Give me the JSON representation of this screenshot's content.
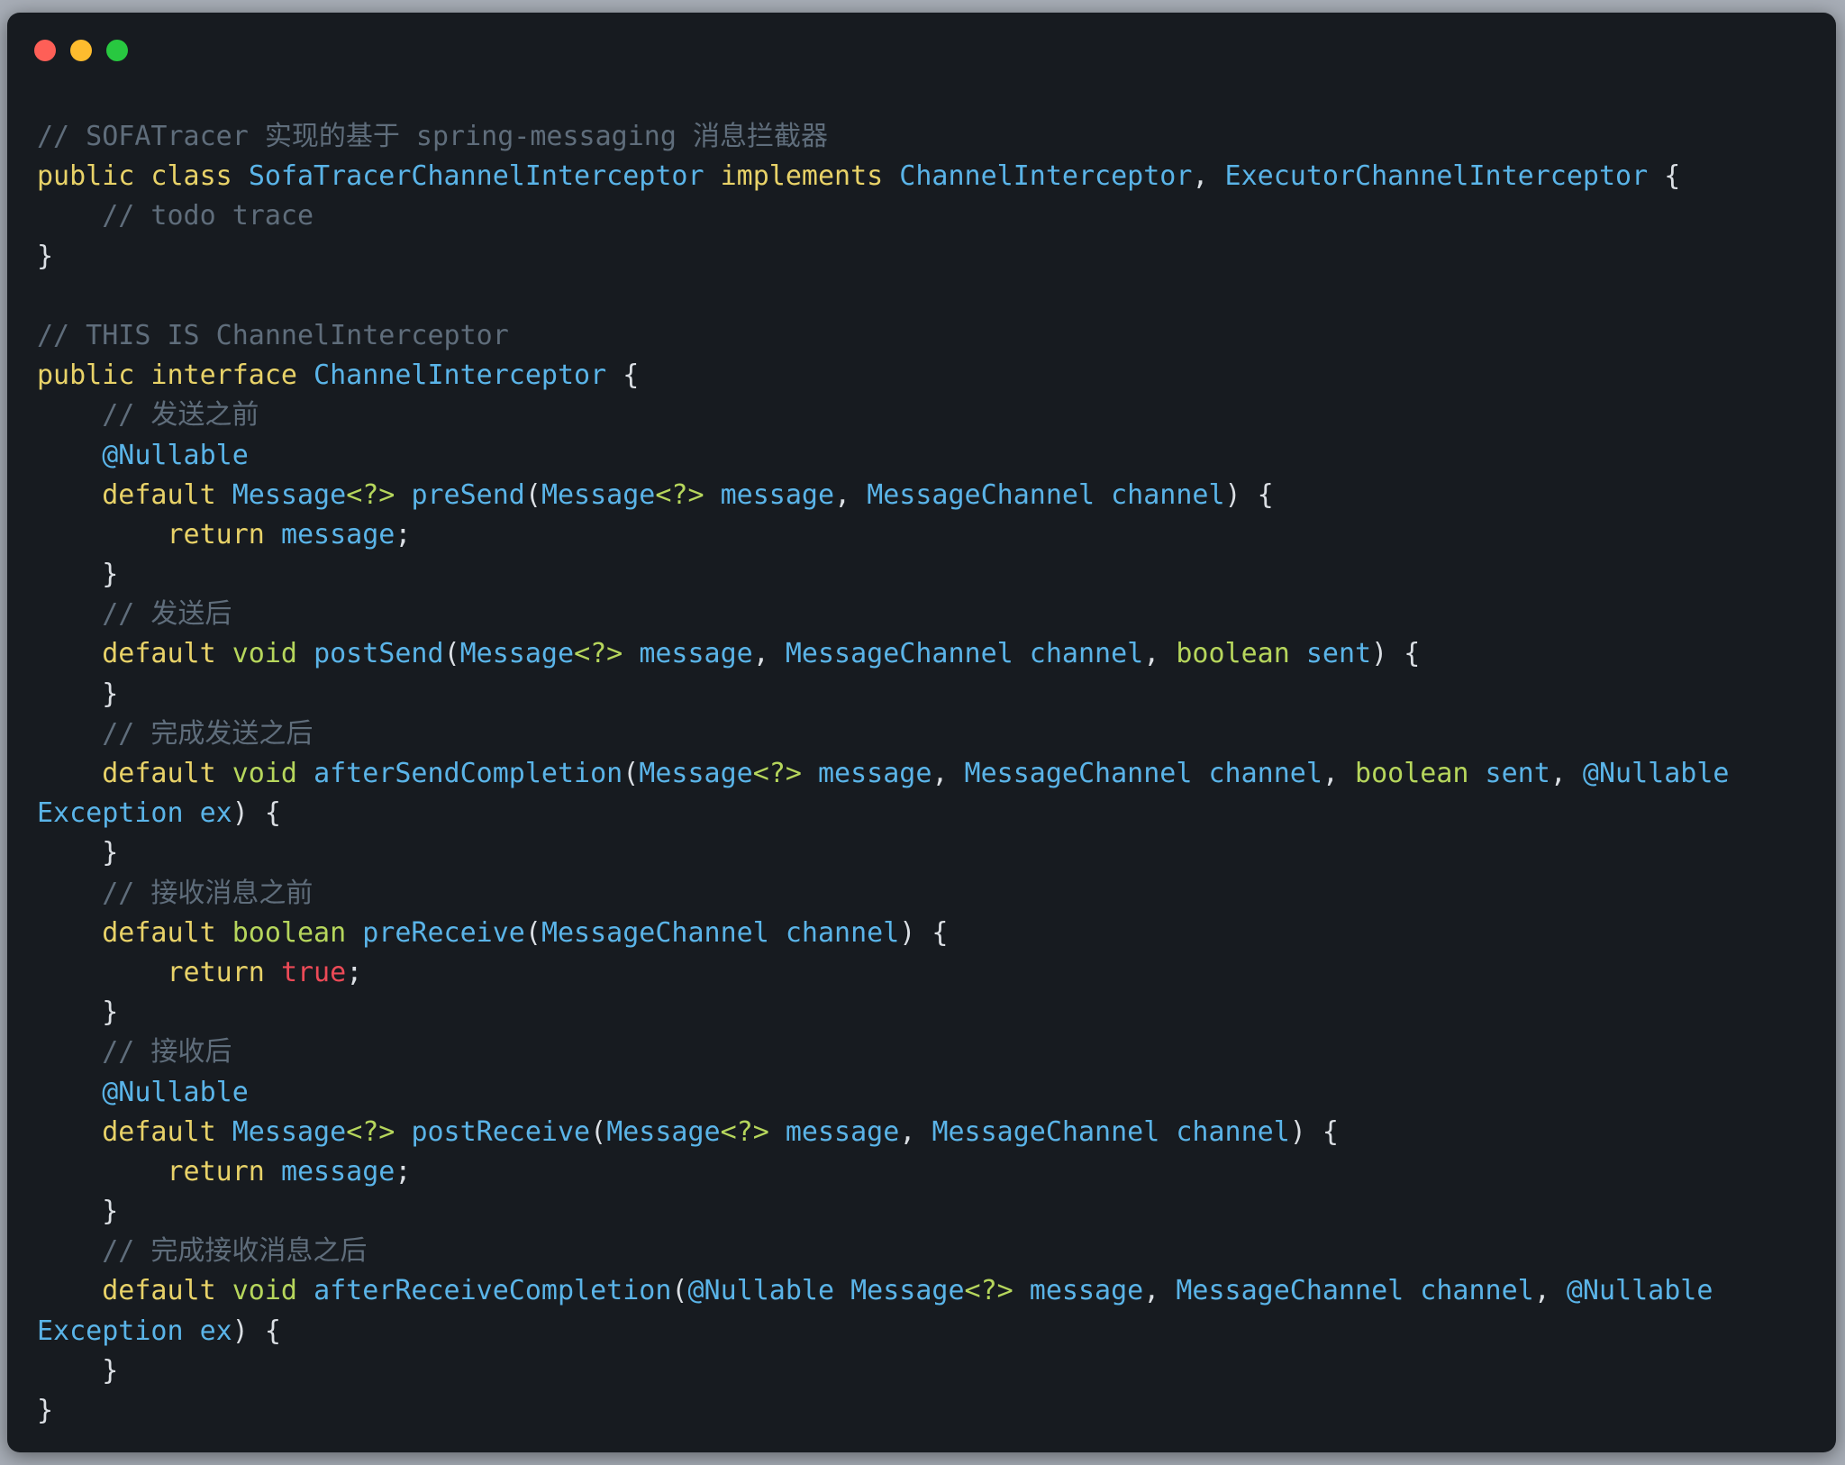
{
  "window": {
    "controls": [
      "close",
      "minimize",
      "maximize"
    ],
    "colors": {
      "close": "#fe5f57",
      "minimize": "#febc2e",
      "maximize": "#28c840",
      "background": "#171b20"
    }
  },
  "code": {
    "language": "java",
    "lines": [
      [
        [
          "cm",
          "// SOFATracer 实现的基于 spring-messaging 消息拦截器"
        ]
      ],
      [
        [
          "kw",
          "public class "
        ],
        [
          "ty",
          "SofaTracerChannelInterceptor "
        ],
        [
          "kw",
          "implements "
        ],
        [
          "ty",
          "ChannelInterceptor"
        ],
        [
          "pl",
          ", "
        ],
        [
          "ty",
          "ExecutorChannelInterceptor "
        ],
        [
          "pl",
          "{"
        ]
      ],
      [
        [
          "pl",
          "    "
        ],
        [
          "cm",
          "// todo trace"
        ]
      ],
      [
        [
          "pl",
          "}"
        ]
      ],
      [],
      [
        [
          "cm",
          "// THIS IS ChannelInterceptor"
        ]
      ],
      [
        [
          "kw",
          "public interface "
        ],
        [
          "ty",
          "ChannelInterceptor "
        ],
        [
          "pl",
          "{"
        ]
      ],
      [
        [
          "pl",
          "    "
        ],
        [
          "cm",
          "// 发送之前"
        ]
      ],
      [
        [
          "pl",
          "    "
        ],
        [
          "ty",
          "@Nullable"
        ]
      ],
      [
        [
          "pl",
          "    "
        ],
        [
          "kw",
          "default "
        ],
        [
          "ty",
          "Message"
        ],
        [
          "gen",
          "<?>"
        ],
        [
          "pl",
          " "
        ],
        [
          "ty",
          "preSend"
        ],
        [
          "pl",
          "("
        ],
        [
          "ty",
          "Message"
        ],
        [
          "gen",
          "<?>"
        ],
        [
          "pl",
          " "
        ],
        [
          "ty",
          "message"
        ],
        [
          "pl",
          ", "
        ],
        [
          "ty",
          "MessageChannel channel"
        ],
        [
          "pl",
          ") {"
        ]
      ],
      [
        [
          "pl",
          "        "
        ],
        [
          "kw",
          "return "
        ],
        [
          "ty",
          "message"
        ],
        [
          "pl",
          ";"
        ]
      ],
      [
        [
          "pl",
          "    }"
        ]
      ],
      [
        [
          "pl",
          "    "
        ],
        [
          "cm",
          "// 发送后"
        ]
      ],
      [
        [
          "pl",
          "    "
        ],
        [
          "kw",
          "default "
        ],
        [
          "prim",
          "void "
        ],
        [
          "ty",
          "postSend"
        ],
        [
          "pl",
          "("
        ],
        [
          "ty",
          "Message"
        ],
        [
          "gen",
          "<?>"
        ],
        [
          "pl",
          " "
        ],
        [
          "ty",
          "message"
        ],
        [
          "pl",
          ", "
        ],
        [
          "ty",
          "MessageChannel channel"
        ],
        [
          "pl",
          ", "
        ],
        [
          "prim",
          "boolean "
        ],
        [
          "ty",
          "sent"
        ],
        [
          "pl",
          ") {"
        ]
      ],
      [
        [
          "pl",
          "    }"
        ]
      ],
      [
        [
          "pl",
          "    "
        ],
        [
          "cm",
          "// 完成发送之后"
        ]
      ],
      [
        [
          "pl",
          "    "
        ],
        [
          "kw",
          "default "
        ],
        [
          "prim",
          "void "
        ],
        [
          "ty",
          "afterSendCompletion"
        ],
        [
          "pl",
          "("
        ],
        [
          "ty",
          "Message"
        ],
        [
          "gen",
          "<?>"
        ],
        [
          "pl",
          " "
        ],
        [
          "ty",
          "message"
        ],
        [
          "pl",
          ", "
        ],
        [
          "ty",
          "MessageChannel channel"
        ],
        [
          "pl",
          ", "
        ],
        [
          "prim",
          "boolean "
        ],
        [
          "ty",
          "sent"
        ],
        [
          "pl",
          ", "
        ],
        [
          "ty",
          "@Nullable"
        ]
      ],
      [
        [
          "ty",
          "Exception ex"
        ],
        [
          "pl",
          ") {"
        ]
      ],
      [
        [
          "pl",
          "    }"
        ]
      ],
      [
        [
          "pl",
          "    "
        ],
        [
          "cm",
          "// 接收消息之前"
        ]
      ],
      [
        [
          "pl",
          "    "
        ],
        [
          "kw",
          "default "
        ],
        [
          "prim",
          "boolean "
        ],
        [
          "ty",
          "preReceive"
        ],
        [
          "pl",
          "("
        ],
        [
          "ty",
          "MessageChannel channel"
        ],
        [
          "pl",
          ") {"
        ]
      ],
      [
        [
          "pl",
          "        "
        ],
        [
          "kw",
          "return "
        ],
        [
          "lit",
          "true"
        ],
        [
          "pl",
          ";"
        ]
      ],
      [
        [
          "pl",
          "    }"
        ]
      ],
      [
        [
          "pl",
          "    "
        ],
        [
          "cm",
          "// 接收后"
        ]
      ],
      [
        [
          "pl",
          "    "
        ],
        [
          "ty",
          "@Nullable"
        ]
      ],
      [
        [
          "pl",
          "    "
        ],
        [
          "kw",
          "default "
        ],
        [
          "ty",
          "Message"
        ],
        [
          "gen",
          "<?>"
        ],
        [
          "pl",
          " "
        ],
        [
          "ty",
          "postReceive"
        ],
        [
          "pl",
          "("
        ],
        [
          "ty",
          "Message"
        ],
        [
          "gen",
          "<?>"
        ],
        [
          "pl",
          " "
        ],
        [
          "ty",
          "message"
        ],
        [
          "pl",
          ", "
        ],
        [
          "ty",
          "MessageChannel channel"
        ],
        [
          "pl",
          ") {"
        ]
      ],
      [
        [
          "pl",
          "        "
        ],
        [
          "kw",
          "return "
        ],
        [
          "ty",
          "message"
        ],
        [
          "pl",
          ";"
        ]
      ],
      [
        [
          "pl",
          "    }"
        ]
      ],
      [
        [
          "pl",
          "    "
        ],
        [
          "cm",
          "// 完成接收消息之后"
        ]
      ],
      [
        [
          "pl",
          "    "
        ],
        [
          "kw",
          "default "
        ],
        [
          "prim",
          "void "
        ],
        [
          "ty",
          "afterReceiveCompletion"
        ],
        [
          "pl",
          "("
        ],
        [
          "ty",
          "@Nullable Message"
        ],
        [
          "gen",
          "<?>"
        ],
        [
          "pl",
          " "
        ],
        [
          "ty",
          "message"
        ],
        [
          "pl",
          ", "
        ],
        [
          "ty",
          "MessageChannel channel"
        ],
        [
          "pl",
          ", "
        ],
        [
          "ty",
          "@Nullable"
        ]
      ],
      [
        [
          "ty",
          "Exception ex"
        ],
        [
          "pl",
          ") {"
        ]
      ],
      [
        [
          "pl",
          "    }"
        ]
      ],
      [
        [
          "pl",
          "}"
        ]
      ]
    ]
  }
}
